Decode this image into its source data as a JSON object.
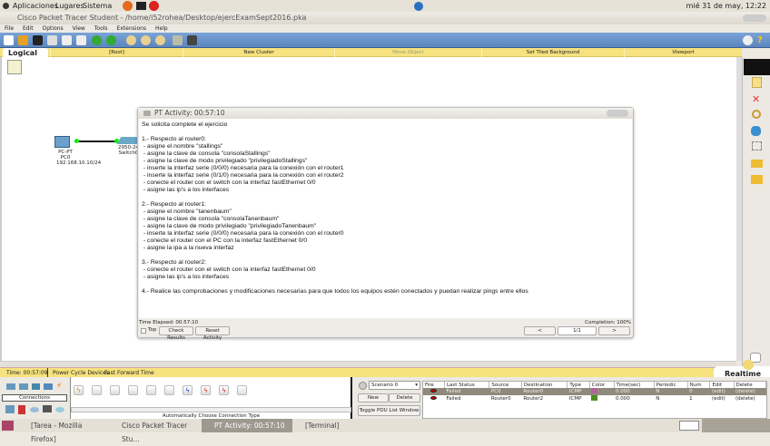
{
  "top_panel": {
    "menus": [
      "Aplicaciones",
      "Lugares",
      "Sistema"
    ],
    "clock": "mié 31 de may, 12:22"
  },
  "window": {
    "title": "Cisco Packet Tracer Student - /home/i52rohea/Desktop/ejercExamSept2016.pka"
  },
  "menu": [
    "File",
    "Edit",
    "Options",
    "View",
    "Tools",
    "Extensions",
    "Help"
  ],
  "logical_bar": {
    "tab": "Logical",
    "root": "[Root]",
    "new_cluster": "New Cluster",
    "move_object": "Move Object",
    "tiled_bg": "Set Tiled Background",
    "viewport": "Viewport"
  },
  "canvas": {
    "pc": {
      "type": "PC-PT",
      "name": "PC0",
      "ip": "192.168.10.10/24"
    },
    "switch": {
      "type": "2950-24",
      "name": "Switch0"
    }
  },
  "dialog": {
    "title": "PT Activity: 00:57:10",
    "lines": [
      "Se solicita complete el ejercicio",
      "",
      "1.- Respecto al router0:",
      " - asigne el nombre \"stallings\"",
      " - asigne la clave de consola \"consolaStallings\"",
      " - asigne la clave de modo privilegiado \"privilegiadoStallings\"",
      " - inserte la interfaz serie (0/0/0) necesaria para la conexión con el router1",
      " - inserte la interfaz serie (0/1/0) necesaria para la conexión con el router2",
      " - conecte el router con el switch con la interfaz fastEthernet 0/0",
      " - asigne las ip's a los interfaces",
      "",
      "2.- Respecto al router1:",
      " - asigne el nombre \"tanenbaum\"",
      " - asigne la clave de consola \"consolaTanenbaum\"",
      " - asigne la clave de modo privilegiado \"privilegiadoTanenbaum\"",
      " - inserte la interfaz serie (0/0/0) necesaria para la conexión con el router0",
      " - conecte el router con el PC con la interfaz fastEthernet 0/0",
      " - asigne la ipa a la nueva interfaz",
      "",
      "3.- Respecto al router2:",
      " - conecte el router con el switch con la interfaz fastEthernet 0/0",
      " - asigne las ip's a los interfaces",
      "",
      "4.- Realice las comprobaciones y modificaciones necesarias para que todos los equipos estén conectados y puedan realizar pings entre ellos"
    ],
    "time_elapsed": "Time Elapsed: 00:57:10",
    "completion": "Completion: 100%",
    "top_label": "Top",
    "check_results": "Check Results",
    "reset_activity": "Reset Activity",
    "prev": "<",
    "page": "1/1",
    "next": ">"
  },
  "status": {
    "time": "Time: 00:57:09",
    "power_cycle": "Power Cycle Devices",
    "fast_forward": "Fast Forward Time",
    "realtime": "Realtime"
  },
  "devices": {
    "category": "Connections",
    "connection_type": "Automatically Choose Connection Type"
  },
  "scenario": {
    "selected": "Scenario 0",
    "new": "New",
    "delete": "Delete",
    "toggle": "Toggle PDU List Window"
  },
  "pdu_table": {
    "headers": [
      "Fire",
      "Last Status",
      "Source",
      "Destination",
      "Type",
      "Color",
      "Time(sec)",
      "Periodic",
      "Num",
      "Edit",
      "Delete"
    ],
    "rows": [
      {
        "status": "Failed",
        "source": "PC0",
        "destination": "Router0",
        "type": "ICMP",
        "color": "#b0649c",
        "time": "0.000",
        "periodic": "N",
        "num": "0",
        "edit": "(edit)",
        "delete": "(delete)"
      },
      {
        "status": "Failed",
        "source": "Router0",
        "destination": "Router2",
        "type": "ICMP",
        "color": "#4e8c1e",
        "time": "0.000",
        "periodic": "N",
        "num": "1",
        "edit": "(edit)",
        "delete": "(delete)"
      }
    ]
  },
  "taskbar": [
    "[Tarea - Mozilla Firefox]",
    "Cisco Packet Tracer Stu...",
    "PT Activity: 00:57:10",
    "[Terminal]"
  ]
}
